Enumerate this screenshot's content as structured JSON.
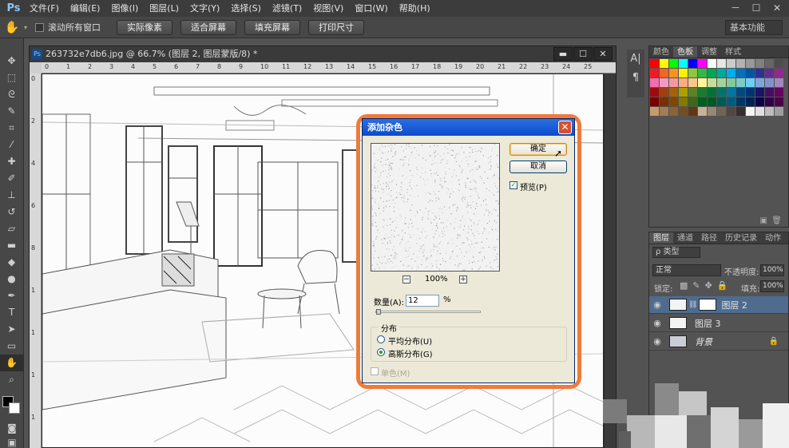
{
  "app": {
    "logo": "Ps",
    "menu": [
      "文件(F)",
      "编辑(E)",
      "图像(I)",
      "图层(L)",
      "文字(Y)",
      "选择(S)",
      "滤镜(T)",
      "视图(V)",
      "窗口(W)",
      "帮助(H)"
    ],
    "window_controls": [
      "－",
      "☐",
      "✕"
    ]
  },
  "options_bar": {
    "scroll_all_label": "滚动所有窗口",
    "buttons": [
      "实际像素",
      "适合屏幕",
      "填充屏幕",
      "打印尺寸"
    ],
    "workspace": "基本功能"
  },
  "document": {
    "title": "263732e7db6.jpg @ 66.7% (图层 2, 图层蒙版/8) *",
    "ruler_top": [
      "0",
      "1",
      "2",
      "3",
      "4",
      "5",
      "6",
      "7",
      "8",
      "9",
      "10",
      "11",
      "12",
      "13",
      "14",
      "15",
      "16",
      "17",
      "18",
      "19",
      "20",
      "21",
      "22",
      "23",
      "24",
      "25"
    ],
    "ruler_left": [
      "0",
      "2",
      "4",
      "6",
      "8",
      "1",
      "1",
      "1",
      "1"
    ]
  },
  "panels": {
    "swatch_tabs": [
      "颜色",
      "色板",
      "调整",
      "样式"
    ],
    "layers_tabs": [
      "图层",
      "通道",
      "路径",
      "历史记录",
      "动作"
    ],
    "kind_label": "ρ 类型",
    "blend_mode": "正常",
    "opacity_label": "不透明度:",
    "opacity_value": "100%",
    "lock_label": "锁定:",
    "fill_label": "填充:",
    "fill_value": "100%",
    "layers": [
      {
        "name": "图层 2",
        "selected": true
      },
      {
        "name": "图层 3",
        "selected": false
      },
      {
        "name": "背景",
        "selected": false
      }
    ]
  },
  "dialog": {
    "title": "添加杂色",
    "ok": "确定",
    "cancel": "取消",
    "preview_label": "预览(P)",
    "zoom": "100%",
    "amount_label": "数量(A):",
    "amount_value": "12",
    "amount_unit": "%",
    "amount_slider_fraction": 0.03,
    "distribution_label": "分布",
    "uniform_label": "平均分布(U)",
    "gaussian_label": "高斯分布(G)",
    "mono_label": "单色(M)"
  }
}
